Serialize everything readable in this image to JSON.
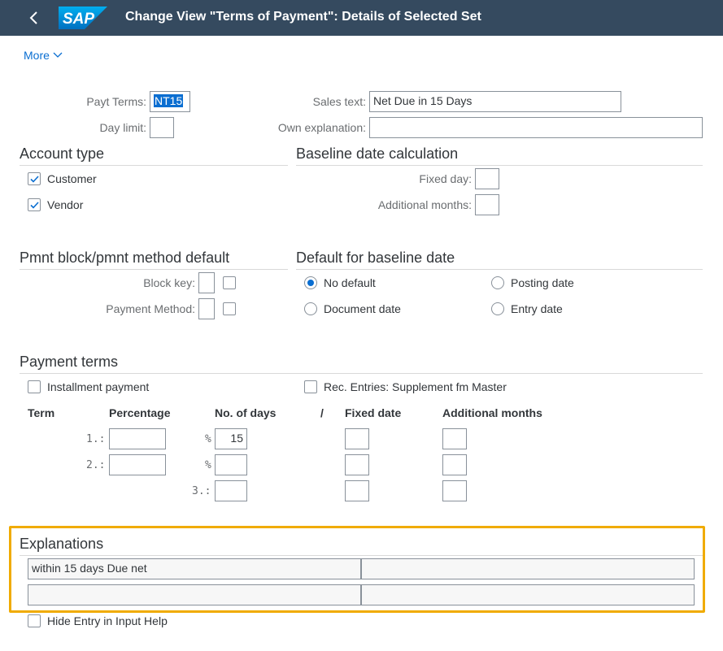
{
  "shell": {
    "title": "Change View \"Terms of Payment\": Details of Selected Set",
    "logo_text": "SAP"
  },
  "toolbar": {
    "more_label": "More"
  },
  "header": {
    "payt_terms_label": "Payt Terms:",
    "payt_terms_value": "NT15",
    "day_limit_label": "Day limit:",
    "day_limit_value": "",
    "sales_text_label": "Sales text:",
    "sales_text_value": "Net Due in 15 Days",
    "own_explanation_label": "Own explanation:",
    "own_explanation_value": ""
  },
  "account_type": {
    "title": "Account type",
    "customer_label": "Customer",
    "customer_checked": true,
    "vendor_label": "Vendor",
    "vendor_checked": true
  },
  "baseline_calc": {
    "title": "Baseline date calculation",
    "fixed_day_label": "Fixed day:",
    "additional_months_label": "Additional months:"
  },
  "pmnt_block": {
    "title": "Pmnt block/pmnt method default",
    "block_key_label": "Block key:",
    "payment_method_label": "Payment Method:"
  },
  "default_baseline": {
    "title": "Default for baseline date",
    "options": [
      "No default",
      "Posting date",
      "Document date",
      "Entry date"
    ],
    "selected": "No default"
  },
  "payment_terms": {
    "title": "Payment terms",
    "installment_label": "Installment payment",
    "rec_entries_label": "Rec. Entries: Supplement fm Master",
    "headers": [
      "Term",
      "Percentage",
      "No. of days",
      "/",
      "Fixed date",
      "Additional months"
    ],
    "rows": [
      {
        "term": "1.:",
        "percentage": "",
        "pct_sign": "%",
        "days": "15"
      },
      {
        "term": "2.:",
        "percentage": "",
        "pct_sign": "%",
        "days": ""
      },
      {
        "term": "3.:",
        "days": ""
      }
    ]
  },
  "explanations": {
    "title": "Explanations",
    "line1_left": "within 15 days Due net",
    "line1_right": "",
    "line2_left": "",
    "line2_right": ""
  },
  "footer": {
    "hide_entry_label": "Hide Entry in Input Help"
  },
  "colors": {
    "shell_bg": "#354a5f",
    "accent": "#0a6ed1",
    "highlight": "#f0ab00"
  }
}
